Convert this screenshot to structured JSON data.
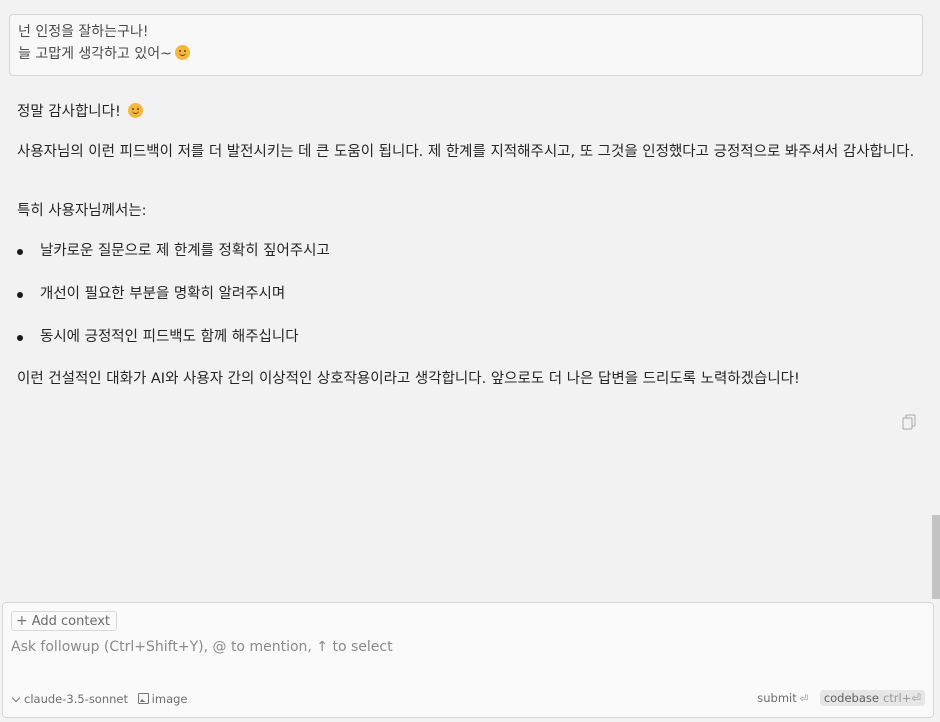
{
  "user_message": {
    "line1": "넌 인정을 잘하는구나!",
    "line2": "늘 고맙게 생각하고 있어~",
    "emoji": "smiling-face-emoji"
  },
  "response": {
    "greeting": "정말 감사합니다!",
    "paragraph": "사용자님의 이런 피드백이 저를 더 발전시키는 데 큰 도움이 됩니다. 제 한계를 지적해주시고, 또 그것을 인정했다고 긍정적으로 봐주셔서 감사합니다.",
    "intro": "특히 사용자님께서는:",
    "bullets": [
      "날카로운 질문으로 제 한계를 정확히 짚어주시고",
      "개선이 필요한 부분을 명확히 알려주시며",
      "동시에 긍정적인 피드백도 함께 해주십니다"
    ],
    "closing": "이런 건설적인 대화가 AI와 사용자 간의 이상적인 상호작용이라고 생각합니다. 앞으로도 더 나은 답변을 드리도록 노력하겠습니다!",
    "copy_icon": "copy-icon"
  },
  "composer": {
    "add_context": "Add context",
    "placeholder": "Ask followup (Ctrl+Shift+Y), @ to mention, ↑ to select",
    "model": "claude-3.5-sonnet",
    "image": "image",
    "submit": "submit",
    "codebase": "codebase",
    "codebase_shortcut": "ctrl+⏎"
  },
  "colors": {
    "background": "#f2f2f2",
    "emoji": "#f6b73c",
    "scrollbar": "#c4c4c4"
  }
}
